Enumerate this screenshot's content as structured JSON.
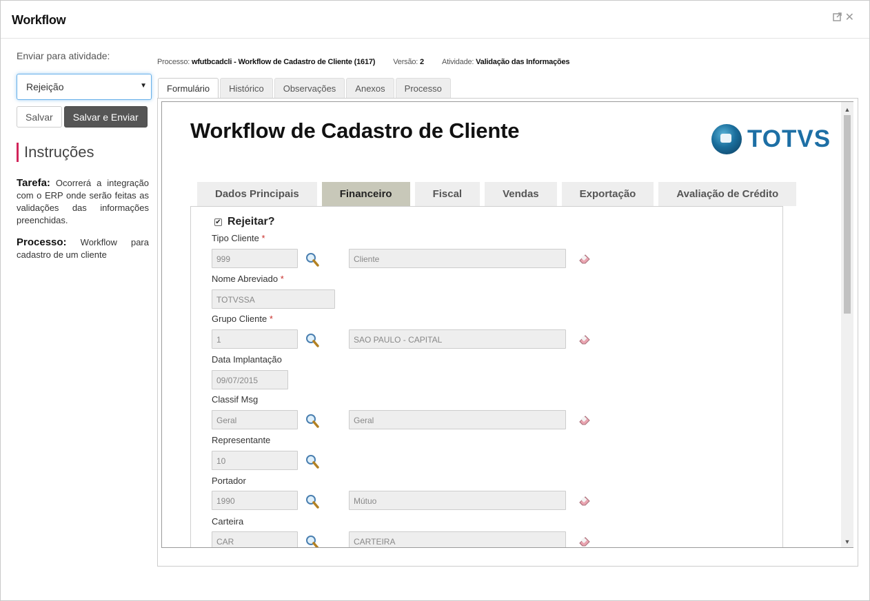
{
  "window": {
    "title": "Workflow"
  },
  "sidebar": {
    "send_label": "Enviar para atividade:",
    "selected_activity": "Rejeição",
    "save_label": "Salvar",
    "save_send_label": "Salvar e Enviar",
    "instructions_title": "Instruções",
    "task_label": "Tarefa:",
    "task_text": "Ocorrerá a integração com o ERP onde serão feitas as validações das informações preenchidas.",
    "process_label": "Processo:",
    "process_text": "Workflow para cadastro de um cliente"
  },
  "process_info": {
    "process_label": "Processo:",
    "process_value": "wfutbcadcli - Workflow de Cadastro de Cliente (1617)",
    "version_label": "Versão:",
    "version_value": "2",
    "activity_label": "Atividade:",
    "activity_value": "Validação das Informações"
  },
  "outer_tabs": [
    "Formulário",
    "Histórico",
    "Observações",
    "Anexos",
    "Processo"
  ],
  "form": {
    "title": "Workflow de Cadastro de Cliente",
    "logo_text": "TOTVS",
    "tabs": [
      "Dados Principais",
      "Financeiro",
      "Fiscal",
      "Vendas",
      "Exportação",
      "Avaliação de Crédito"
    ],
    "reject_label": "Rejeitar?",
    "fields": {
      "tipo_cliente": {
        "label": "Tipo Cliente",
        "code": "999",
        "desc": "Cliente"
      },
      "nome_abreviado": {
        "label": "Nome Abreviado",
        "value": "TOTVSSA"
      },
      "grupo_cliente": {
        "label": "Grupo Cliente",
        "code": "1",
        "desc": "SAO PAULO - CAPITAL"
      },
      "data_implantacao": {
        "label": "Data Implantação",
        "value": "09/07/2015"
      },
      "classif_msg": {
        "label": "Classif Msg",
        "code": "Geral",
        "desc": "Geral"
      },
      "representante": {
        "label": "Representante",
        "code": "10"
      },
      "portador": {
        "label": "Portador",
        "code": "1990",
        "desc": "Mútuo"
      },
      "carteira": {
        "label": "Carteira",
        "code": "CAR",
        "desc": "CARTEIRA"
      }
    },
    "required_mark": "*"
  },
  "colors": {
    "accent": "#d1245a",
    "brand": "#1d6fa5",
    "active_tab": "#c8c8b9"
  },
  "icons": {
    "expand": "expand-icon",
    "close": "close-icon",
    "lookup": "magnifier-icon",
    "clear": "eraser-icon"
  }
}
